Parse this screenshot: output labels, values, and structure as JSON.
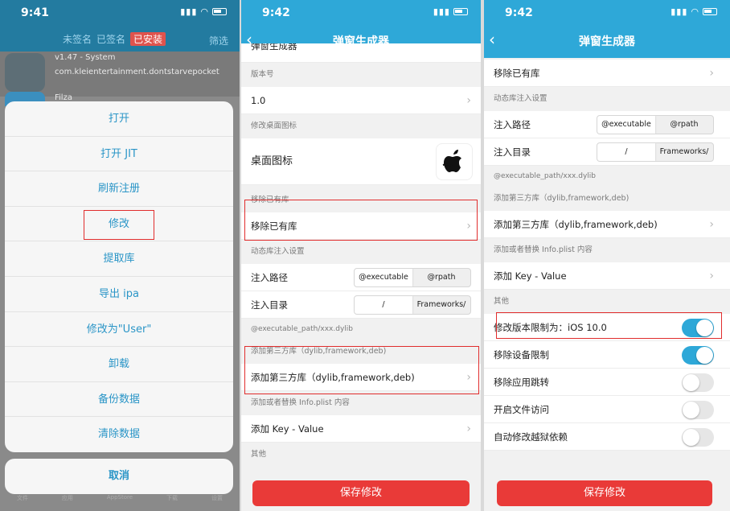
{
  "status": {
    "time_1": "9:41",
    "time_2": "9:42",
    "time_3": "9:42"
  },
  "panel1": {
    "tabs": [
      "未签名",
      "已签名",
      "已安装"
    ],
    "filter": "筛选",
    "bg_app": {
      "version": "v1.47 - System",
      "bundle": "com.kleientertainment.dontstarvepocket",
      "next_app": "Filza"
    },
    "menu": [
      "打开",
      "打开 JIT",
      "刷新注册",
      "修改",
      "提取库",
      "导出 ipa",
      "修改为\"User\"",
      "卸载",
      "备份数据",
      "清除数据"
    ],
    "cancel": "取消",
    "tabbar": [
      "文件",
      "应用",
      "AppStore",
      "下载",
      "设置"
    ]
  },
  "panel2": {
    "title": "弹窗生成器",
    "partial_row": "弹窗生成器",
    "version_header": "版本号",
    "version_value": "1.0",
    "icon_header": "修改桌面图标",
    "icon_label": "桌面图标",
    "remove_header": "移除已有库",
    "remove_label": "移除已有库",
    "inject_header": "动态库注入设置",
    "inject_path_label": "注入路径",
    "inject_path_opts": [
      "@executable",
      "@rpath"
    ],
    "inject_dir_label": "注入目录",
    "inject_dir_opts": [
      "/",
      "Frameworks/"
    ],
    "inject_hint": "@executable_path/xxx.dylib",
    "third_header": "添加第三方库（dylib,framework,deb)",
    "third_label": "添加第三方库（dylib,framework,deb)",
    "plist_header": "添加或者替换 Info.plist 内容",
    "plist_label": "添加 Key - Value",
    "other_header": "其他",
    "save": "保存修改"
  },
  "panel3": {
    "title": "弹窗生成器",
    "remove_label": "移除已有库",
    "inject_header": "动态库注入设置",
    "inject_path_label": "注入路径",
    "inject_path_opts": [
      "@executable",
      "@rpath"
    ],
    "inject_dir_label": "注入目录",
    "inject_dir_opts": [
      "/",
      "Frameworks/"
    ],
    "inject_hint": "@executable_path/xxx.dylib",
    "third_header": "添加第三方库（dylib,framework,deb)",
    "third_label": "添加第三方库（dylib,framework,deb)",
    "plist_header": "添加或者替换 Info.plist 内容",
    "plist_label": "添加 Key - Value",
    "other_header": "其他",
    "toggles": [
      {
        "label": "修改版本限制为：iOS 10.0",
        "on": true
      },
      {
        "label": "移除设备限制",
        "on": true
      },
      {
        "label": "移除应用跳转",
        "on": false
      },
      {
        "label": "开启文件访问",
        "on": false
      },
      {
        "label": "自动修改越狱依赖",
        "on": false
      }
    ],
    "save": "保存修改"
  },
  "colors": {
    "accent": "#2ea8d8",
    "danger": "#e93a38",
    "highlight_box": "#e12d2d"
  }
}
